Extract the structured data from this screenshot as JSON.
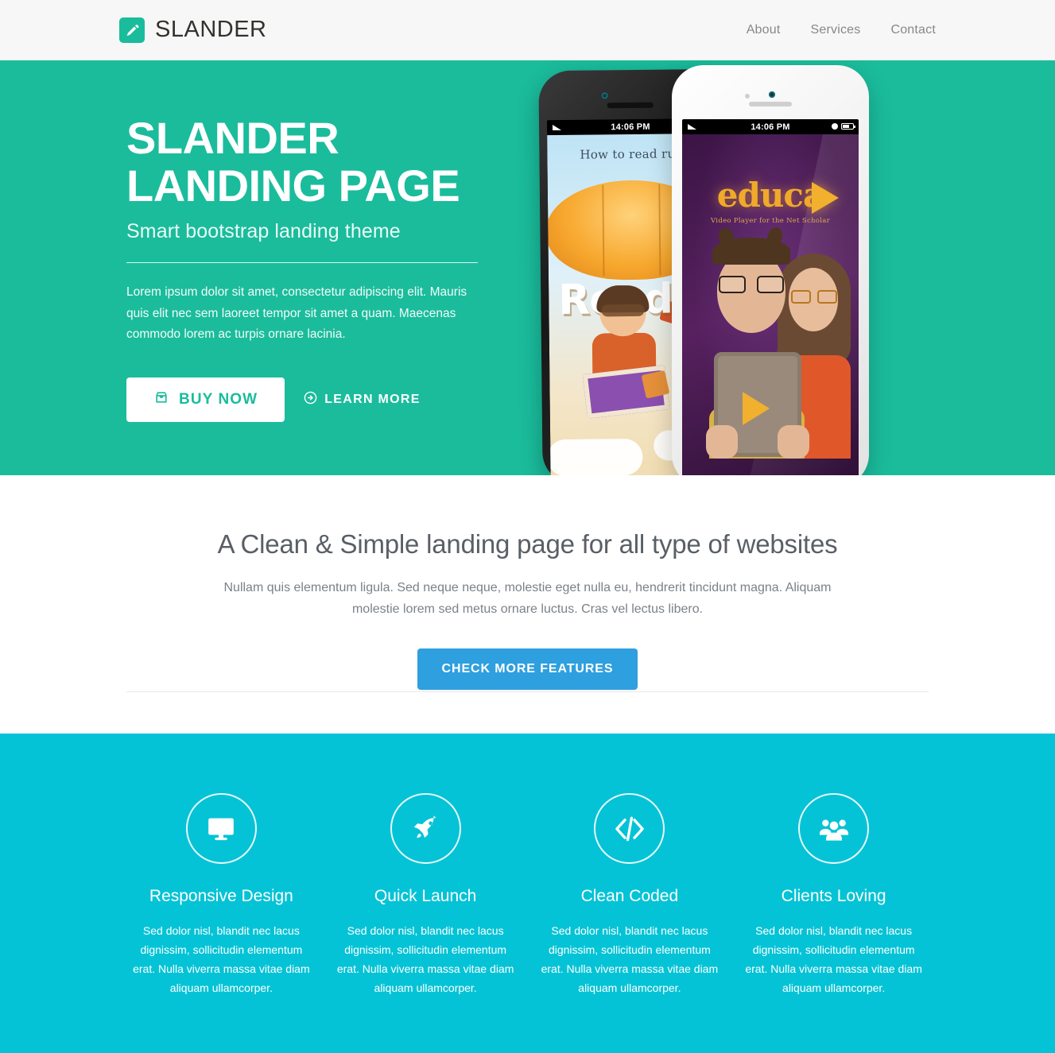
{
  "header": {
    "brand_name": "SLANDER",
    "brand_icon": "pencil-icon",
    "nav": [
      {
        "label": "About"
      },
      {
        "label": "Services"
      },
      {
        "label": "Contact"
      }
    ]
  },
  "hero": {
    "title_line1": "SLANDER",
    "title_line2": "LANDING PAGE",
    "subtitle": "Smart bootstrap landing theme",
    "paragraph": "Lorem ipsum dolor sit amet, consectetur adipiscing elit. Mauris quis elit nec sem laoreet tempor sit amet a quam. Maecenas commodo lorem ac turpis ornare lacinia.",
    "buy_label": "BUY NOW",
    "buy_icon": "inbox-icon",
    "learn_label": "LEARN MORE",
    "learn_icon": "circle-arrow-right-icon",
    "background_color": "#1abc9c",
    "phones": {
      "black_phone": {
        "status_time": "14:06 PM",
        "app_heading": "How to read rus",
        "app_word": "Read"
      },
      "white_phone": {
        "status_time": "14:06 PM",
        "app_logo": "educa",
        "app_tagline": "Video Player for the Net Scholar"
      }
    }
  },
  "intro": {
    "title": "A Clean & Simple landing page for all type of websites",
    "paragraph": "Nullam quis elementum ligula. Sed neque neque, molestie eget nulla eu, hendrerit tincidunt magna. Aliquam molestie lorem sed metus ornare luctus. Cras vel lectus libero.",
    "button_label": "CHECK MORE FEATURES",
    "button_color": "#2e9fdf"
  },
  "features": {
    "background_color": "#05c3d6",
    "items": [
      {
        "icon": "desktop-monitor-icon",
        "title": "Responsive Design",
        "text": "Sed dolor nisl, blandit nec lacus dignissim, sollicitudin elementum erat. Nulla viverra massa vitae diam aliquam ullamcorper."
      },
      {
        "icon": "rocket-icon",
        "title": "Quick Launch",
        "text": "Sed dolor nisl, blandit nec lacus dignissim, sollicitudin elementum erat. Nulla viverra massa vitae diam aliquam ullamcorper."
      },
      {
        "icon": "code-brackets-icon",
        "title": "Clean Coded",
        "text": "Sed dolor nisl, blandit nec lacus dignissim, sollicitudin elementum erat. Nulla viverra massa vitae diam aliquam ullamcorper."
      },
      {
        "icon": "users-group-icon",
        "title": "Clients Loving",
        "text": "Sed dolor nisl, blandit nec lacus dignissim, sollicitudin elementum erat. Nulla viverra massa vitae diam aliquam ullamcorper."
      }
    ]
  }
}
